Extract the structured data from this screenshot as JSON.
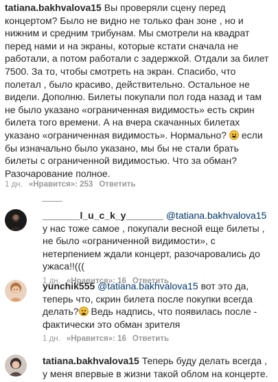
{
  "main_comment": {
    "username": "tatiana.bakhvalova15",
    "text_before_emoji": "Вы проверяли сцену перед концертом? Было не видно не только фан зоне , но и нижним и средним трибунам. Мы смотрели на квадрат перед нами и на экраны, которые кстати сначала не работали, а потом работали с задержкой. Отдали за билет 7500. За то, чтобы смотреть на экран. Спасибо, что полетал , было красиво, действительно. Остальное не видели. Дополню. Билеты покупали пол года назад и там не было указано «ограниченная видимость» есть скрин билета того времени. А на вчера скачанных билетах указано «ограниченная видимость». Нормально?",
    "emoji": "grinning-sweat-emoji",
    "text_after_emoji": "если бы изначально было указано, мы бы не стали брать билеты с ограниченной видимостью. Что за обман? Разочарование полное.",
    "time": "1 дн.",
    "likes": "«Нравится»: 253",
    "reply_label": "Ответить"
  },
  "replies": [
    {
      "username": "_______l_u_c_k_y_______",
      "mention": "@tatiana.bakhvalova15",
      "text": "у нас тоже самое , покупали весной еще билеты , не было «ограниченной видимости», с нетерпением ждали концерт, разочаровались до ужаса!!(((",
      "time": "1 дн.",
      "likes": "«Нравится»: 16",
      "reply_label": "Ответить"
    },
    {
      "username": "yunchik555",
      "mention": "@tatiana.bakhvalova15",
      "text_before_emoji": "вот это да, теперь что, скрин билета после покупки всегда делать?",
      "emoji": "worried-face-emoji",
      "text_after_emoji": "Ведь надпись, что появилась после - фактически это обман зрителя",
      "time": "1 дн.",
      "likes": "«Нравится»: 16",
      "reply_label": "Ответить"
    },
    {
      "username": "tatiana.bakhvalova15",
      "text": "Теперь буду делать всегда , у меня впервые в жизни такой облом на концерте."
    }
  ]
}
